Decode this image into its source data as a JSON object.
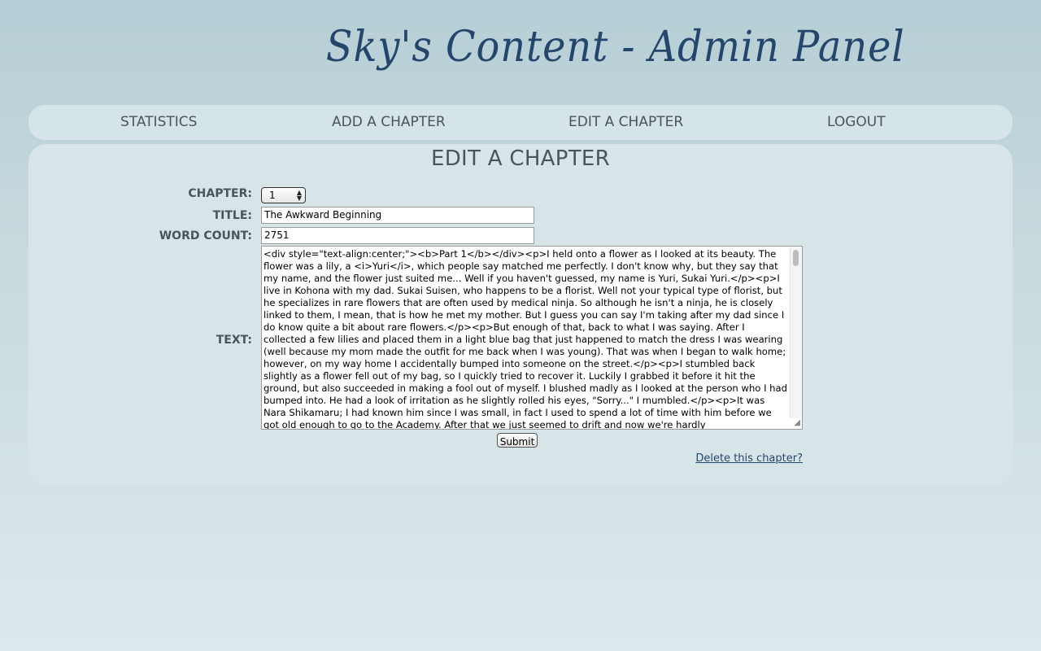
{
  "header": {
    "title": "Sky's Content - Admin Panel"
  },
  "nav": {
    "items": [
      {
        "label": "STATISTICS"
      },
      {
        "label": "ADD A CHAPTER"
      },
      {
        "label": "EDIT A CHAPTER"
      },
      {
        "label": "LOGOUT"
      }
    ]
  },
  "main": {
    "title": "EDIT A CHAPTER",
    "form": {
      "chapter_label": "CHAPTER:",
      "chapter_value": "1",
      "title_label": "TITLE:",
      "title_value": "The Awkward Beginning",
      "word_count_label": "WORD COUNT:",
      "word_count_value": "2751",
      "text_label": "TEXT:",
      "text_value": "<div style=\"text-align:center;\"><b>Part 1</b></div><p>I held onto a flower as I looked at its beauty. The flower was a lily, a <i>Yuri</i>, which people say matched me perfectly. I don't know why, but they say that my name, and the flower just suited me... Well if you haven't guessed, my name is Yuri, Sukai Yuri.</p><p>I live in Kohona with my dad. Sukai Suisen, who happens to be a florist. Well not your typical type of florist, but he specializes in rare flowers that are often used by medical ninja. So although he isn't a ninja, he is closely linked to them, I mean, that is how he met my mother. But I guess you can say I'm taking after my dad since I do know quite a bit about rare flowers.</p><p>But enough of that, back to what I was saying. After I collected a few lilies and placed them in a light blue bag that just happened to match the dress I was wearing (well because my mom made the outfit for me back when I was young). That was when I began to walk home; however, on my way home I accidentally bumped into someone on the street.</p><p>I stumbled back slightly as a flower fell out of my bag, so I quickly tried to recover it. Luckily I grabbed it before it hit the ground, but also succeeded in making a fool out of myself. I blushed madly as I looked at the person who I had bumped into. He had a look of irritation as he slightly rolled his eyes, \"Sorry...\" I mumbled.</p><p>It was Nara Shikamaru; I had known him since I was small, in fact I used to spend a lot of time with him before we got old enough to go to the Academy. After that we just seemed to drift and now we're hardly",
      "submit_label": "Submit",
      "delete_label": "Delete this chapter?"
    }
  }
}
